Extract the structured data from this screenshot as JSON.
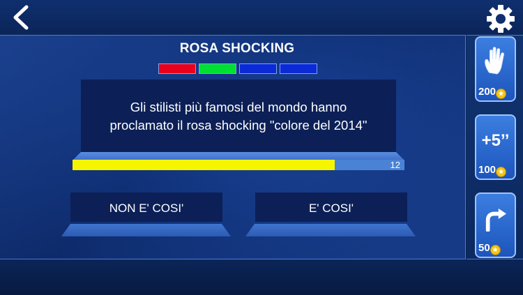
{
  "question": {
    "title": "ROSA SHOCKING",
    "lines": [
      "Gli stilisti più famosi del mondo hanno",
      "proclamato il rosa shocking \"colore del 2014\""
    ],
    "timer_value": "12",
    "timer_fraction": 0.79
  },
  "progress_strip": [
    {
      "color": "#e8001c"
    },
    {
      "color": "#00e033"
    },
    {
      "color": "#0a2ad8"
    },
    {
      "color": "#0a2ad8"
    }
  ],
  "answers": {
    "false_label": "NON E' COSI'",
    "true_label": "E' COSI'"
  },
  "powerups": {
    "hand": {
      "icon": "hand-icon",
      "cost": "200"
    },
    "time": {
      "label": "+5’’",
      "cost": "100"
    },
    "skip": {
      "icon": "skip-arrow-icon",
      "cost": "50"
    }
  },
  "icons": {
    "back": "back-chevron-icon",
    "settings": "gear-icon",
    "coin": "coin-icon"
  }
}
